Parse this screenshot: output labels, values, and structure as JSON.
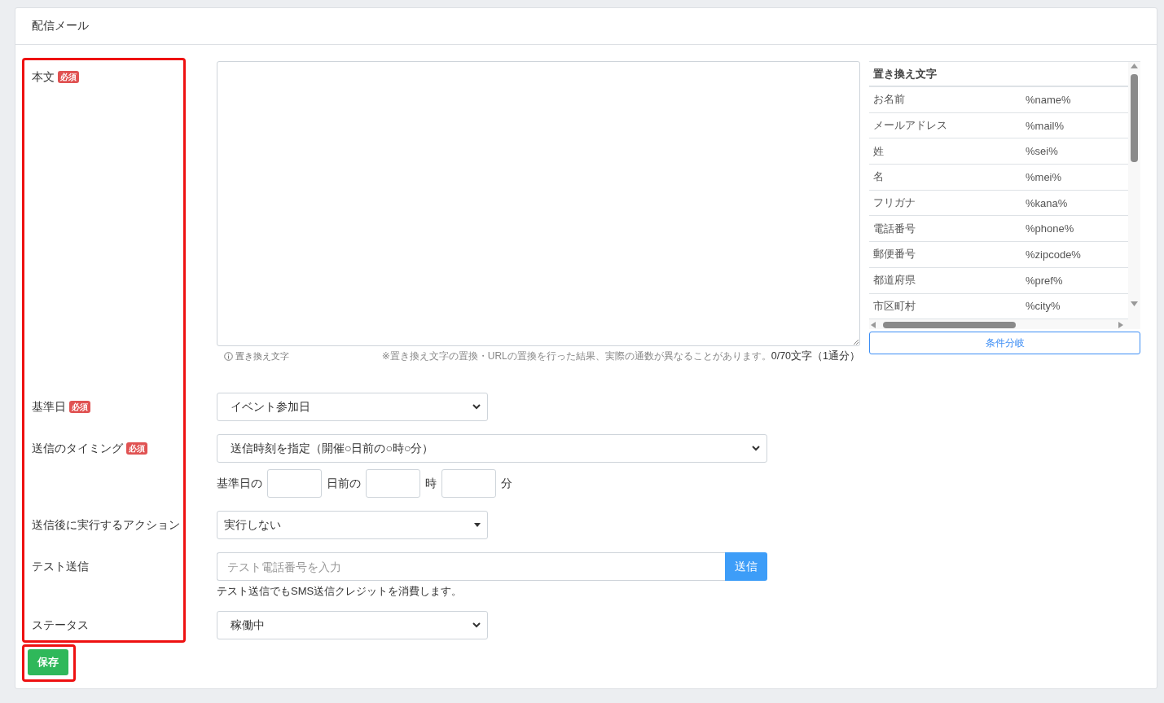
{
  "card_title": "配信メール",
  "highlight_labels": true,
  "fields": [
    {
      "kind": "message",
      "label": "本文",
      "badge": "必須",
      "hint_link": "置き換え文字",
      "note": "※置き換え文字の置換・URLの置換を行った結果、実際の通数が異なることがあります。",
      "counter": "0/70文字（1通分）"
    },
    {
      "kind": "select",
      "label": "基準日",
      "badge": "必須",
      "value": "イベント参加日"
    },
    {
      "kind": "timing",
      "label": "送信のタイミング",
      "badge": "必須",
      "value": "送信時刻を指定（開催○日前の○時○分）",
      "parts": [
        "基準日の",
        "日前の",
        "時",
        "分"
      ]
    },
    {
      "kind": "dropdown",
      "label": "送信後に実行するアクション",
      "value": "実行しない"
    },
    {
      "kind": "test",
      "label": "テスト送信",
      "placeholder": "テスト電話番号を入力",
      "button": "送信",
      "note": "テスト送信でもSMS送信クレジットを消費します。"
    },
    {
      "kind": "select",
      "label": "ステータス",
      "value": "稼働中"
    }
  ],
  "replacements": {
    "title": "置き換え文字",
    "button": "条件分岐",
    "rows": [
      {
        "name": "お名前",
        "code": "%name%"
      },
      {
        "name": "メールアドレス",
        "code": "%mail%"
      },
      {
        "name": "姓",
        "code": "%sei%"
      },
      {
        "name": "名",
        "code": "%mei%"
      },
      {
        "name": "フリガナ",
        "code": "%kana%"
      },
      {
        "name": "電話番号",
        "code": "%phone%"
      },
      {
        "name": "郵便番号",
        "code": "%zipcode%"
      },
      {
        "name": "都道府県",
        "code": "%pref%"
      },
      {
        "name": "市区町村",
        "code": "%city%"
      }
    ]
  },
  "save": {
    "label": "保存",
    "highlighted": true
  }
}
